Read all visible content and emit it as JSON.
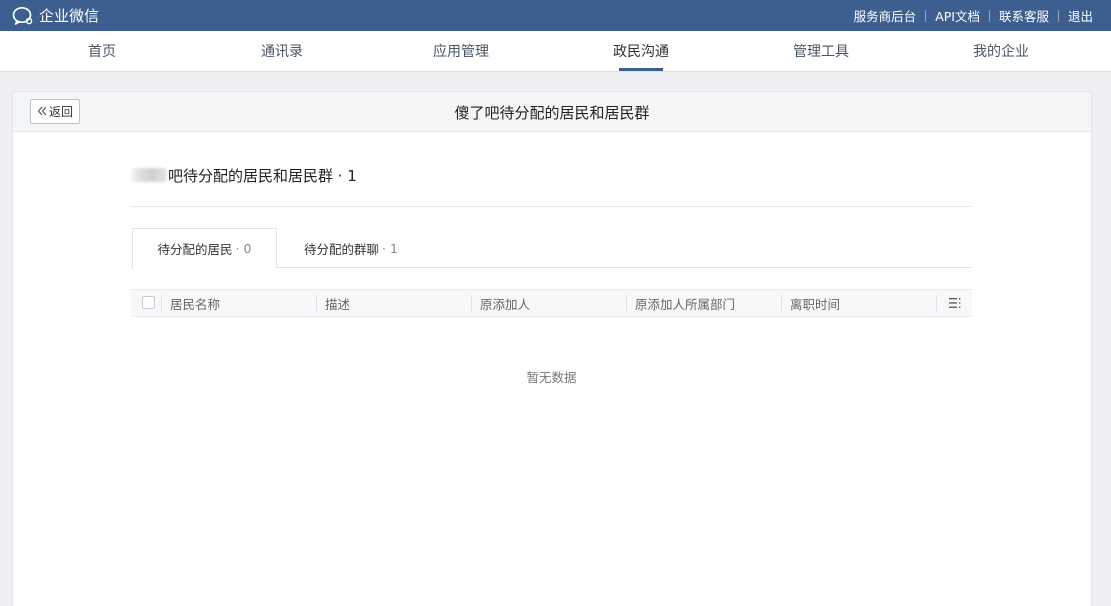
{
  "app": {
    "brand_name": "企业微信",
    "links": [
      "服务商后台",
      "API文档",
      "联系客服",
      "退出"
    ]
  },
  "nav": {
    "items": [
      "首页",
      "通讯录",
      "应用管理",
      "政民沟通",
      "管理工具",
      "我的企业"
    ],
    "active": "政民沟通"
  },
  "page": {
    "back_label": "返回",
    "title": "傻了吧待分配的居民和居民群",
    "section_title": "吧待分配的居民和居民群 · 1"
  },
  "tabs": [
    {
      "label": "待分配的居民",
      "count": "· 0",
      "active": true
    },
    {
      "label": "待分配的群聊",
      "count": "· 1",
      "active": false
    }
  ],
  "table": {
    "columns": [
      "居民名称",
      "描述",
      "原添加人",
      "原添加人所属部门",
      "离职时间"
    ],
    "empty_text": "暂无数据"
  },
  "colors": {
    "topbar": "#3d5f8f",
    "accent": "#3d5f8f"
  }
}
